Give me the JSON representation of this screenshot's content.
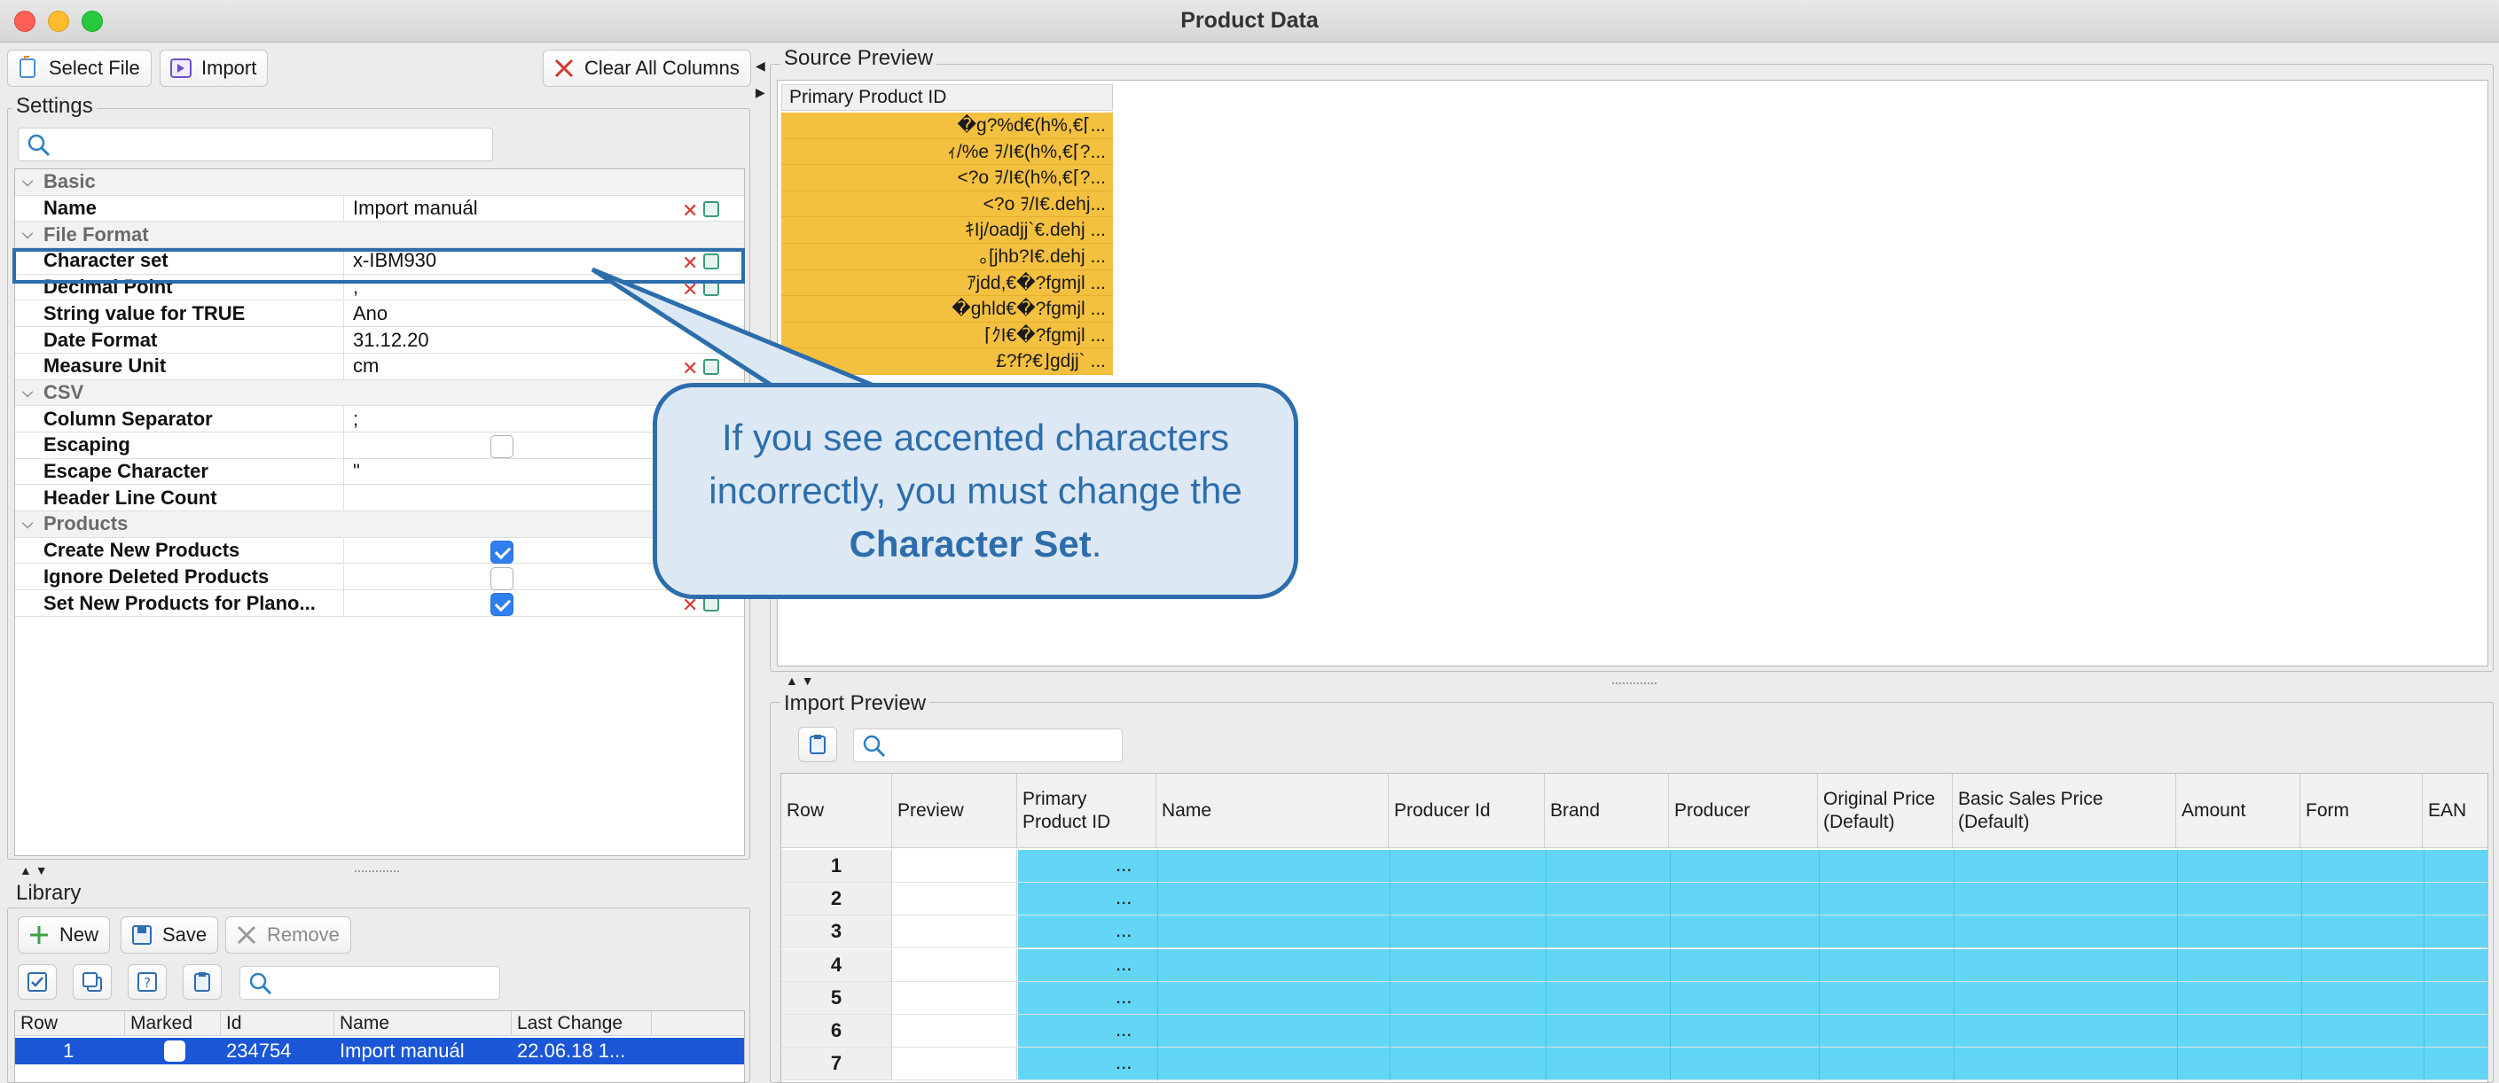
{
  "window": {
    "title": "Product Data"
  },
  "toolbar": {
    "select_file": "Select File",
    "import": "Import",
    "clear_all": "Clear All Columns"
  },
  "settings": {
    "title": "Settings",
    "rows": [
      {
        "type": "section",
        "label": "Basic"
      },
      {
        "type": "text",
        "key": "Name",
        "value": "Import manuál",
        "actions": true
      },
      {
        "type": "section",
        "label": "File Format"
      },
      {
        "type": "text",
        "key": "Character set",
        "value": "x-IBM930",
        "actions": true
      },
      {
        "type": "text",
        "key": "Decimal Point",
        "value": ",",
        "actions": true
      },
      {
        "type": "text",
        "key": "String value for TRUE",
        "value": "Ano",
        "actions": false
      },
      {
        "type": "text",
        "key": "Date Format",
        "value": "31.12.20",
        "actions": false
      },
      {
        "type": "text",
        "key": "Measure Unit",
        "value": "cm",
        "actions": true
      },
      {
        "type": "section",
        "label": "CSV"
      },
      {
        "type": "text",
        "key": "Column Separator",
        "value": ";",
        "actions": false
      },
      {
        "type": "check",
        "key": "Escaping",
        "checked": false,
        "actions": false
      },
      {
        "type": "text",
        "key": "Escape Character",
        "value": "\"",
        "actions": false
      },
      {
        "type": "text",
        "key": "Header Line Count",
        "value": "",
        "actions": false
      },
      {
        "type": "section",
        "label": "Products"
      },
      {
        "type": "check",
        "key": "Create New Products",
        "checked": true,
        "actions": false
      },
      {
        "type": "check",
        "key": "Ignore Deleted Products",
        "checked": false,
        "actions": false
      },
      {
        "type": "check",
        "key": "Set New Products for Plano...",
        "checked": true,
        "actions": true
      }
    ]
  },
  "source_preview": {
    "title": "Source Preview",
    "column": "Primary Product ID",
    "cells": [
      "�g?%d€(h%,€⌈...",
      "ｨ/%e ｦ/I€(h%,€⌈?...",
      "<?o ｦ/I€(h%,€⌈?...",
      "<?o ｦ/I€.dehj...",
      "ｷIj/oadjj`€.dehj   ...",
      "｡[jhb?I€.dehj      ...",
      "ｱjdd,€�?fgmjl      ...",
      "�ghld€�?fgmjl   ...",
      "⌈ｸI€�?fgmjl      ...",
      "£?f?€⌋gdjj`      ..."
    ]
  },
  "callout": {
    "before": "If you see accented characters incorrectly, you must change the ",
    "emph": "Character Set",
    "after": "."
  },
  "import_preview": {
    "title": "Import Preview",
    "columns": [
      "Row",
      "Preview",
      "Primary Product ID",
      "Name",
      "Producer Id",
      "Brand",
      "Producer",
      "Original Price (Default)",
      "Basic Sales Price (Default)",
      "Amount",
      "Form",
      "EAN"
    ],
    "rows": [
      "1",
      "2",
      "3",
      "4",
      "5",
      "6",
      "7"
    ],
    "ellipsis": "..."
  },
  "library": {
    "title": "Library",
    "new": "New",
    "save": "Save",
    "remove": "Remove",
    "columns": [
      "Row",
      "Marked",
      "Id",
      "Name",
      "Last Change"
    ],
    "row": {
      "row": "1",
      "id": "234754",
      "name": "Import manuál",
      "last_change": "22.06.18 1..."
    }
  },
  "colors": {
    "accent": "#2e6dab",
    "source_fill": "#f4c040",
    "import_fill": "#63d6f5",
    "selection": "#1a56d6"
  }
}
